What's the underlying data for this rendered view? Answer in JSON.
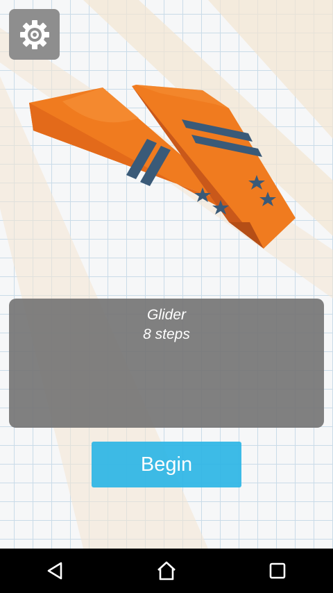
{
  "level": {
    "name": "Glider",
    "steps_text": "8 steps"
  },
  "actions": {
    "begin_label": "Begin"
  },
  "icons": {
    "settings": "gear-icon",
    "nav_back": "back-triangle-icon",
    "nav_home": "home-icon",
    "nav_recents": "recents-square-icon"
  },
  "colors": {
    "plane_primary": "#f07b1f",
    "plane_dark": "#d8621a",
    "plane_stripe": "#3a5a78",
    "button": "#2eb6e6",
    "panel": "#757575",
    "grid": "#c9dbe8"
  }
}
